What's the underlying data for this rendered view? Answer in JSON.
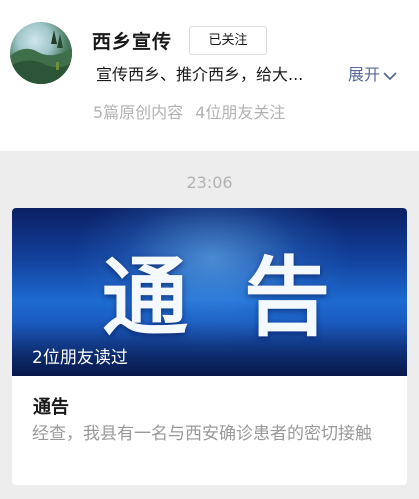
{
  "profile": {
    "name": "西乡宣传",
    "follow_label": "已关注",
    "description": "宣传西乡、推介西乡，给大...",
    "expand_label": "展开",
    "original_count": "5篇原创内容",
    "friends_following": "4位朋友关注"
  },
  "timestamp": "23:06",
  "article": {
    "cover_text": "通告",
    "friends_read": "2位朋友读过",
    "title": "通告",
    "digest": "经查，我县有一名与西安确诊患者的密切接触"
  },
  "colors": {
    "link": "#576b95",
    "secondary_text": "#b2b2b2",
    "background": "#ededed"
  }
}
